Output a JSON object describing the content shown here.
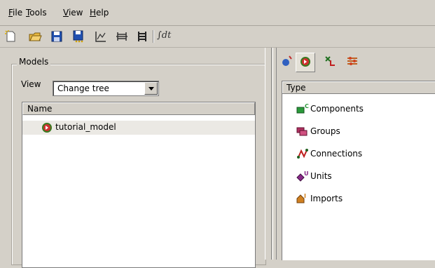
{
  "menubar": {
    "items": [
      {
        "label": "File",
        "mnemonic": "F",
        "rest": "ile"
      },
      {
        "label": "Tools",
        "mnemonic": "T",
        "rest": "ools"
      },
      {
        "label": "View",
        "mnemonic": "V",
        "rest": "iew"
      },
      {
        "label": "Help",
        "mnemonic": "H",
        "rest": "elp"
      }
    ]
  },
  "toolbar": {
    "icons": [
      "new-icon",
      "open-icon",
      "save-icon",
      "save-all-icon",
      "plot-icon",
      "simulate-icon",
      "simulate-all-icon",
      "equation-icon"
    ],
    "equation_label": "∫dt"
  },
  "models": {
    "group_title": "Models",
    "view_label": "View",
    "view_selected": "Change tree",
    "tree_header": "Name",
    "tree_items": [
      "tutorial_model"
    ]
  },
  "library": {
    "tab_icons": [
      "class-icon",
      "model-icon",
      "variable-icon",
      "settings-icon"
    ],
    "active_tab": 1,
    "header": "Type",
    "items": [
      {
        "label": "Components",
        "icon": "components-icon",
        "color": "#2a9a3a"
      },
      {
        "label": "Groups",
        "icon": "groups-icon",
        "color": "#b03060"
      },
      {
        "label": "Connections",
        "icon": "connections-icon",
        "color": "#c02020"
      },
      {
        "label": "Units",
        "icon": "units-icon",
        "color": "#8a2a8a"
      },
      {
        "label": "Imports",
        "icon": "imports-icon",
        "color": "#d08020"
      }
    ]
  }
}
